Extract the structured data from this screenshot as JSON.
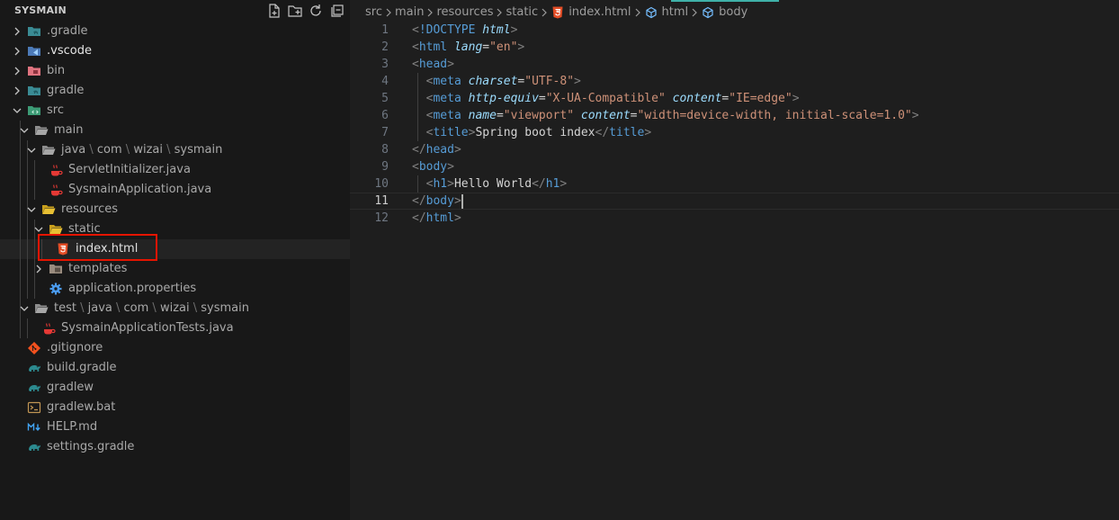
{
  "explorer": {
    "title": "SYSMAIN",
    "actions": [
      "new-file",
      "new-folder",
      "refresh",
      "collapse-all"
    ],
    "items": [
      {
        "label": ".gradle",
        "depth": 0,
        "type": "folder",
        "expanded": false,
        "icon": "folder-gradle-icon"
      },
      {
        "label": ".vscode",
        "depth": 0,
        "type": "folder",
        "expanded": false,
        "icon": "folder-vscode-icon"
      },
      {
        "label": "bin",
        "depth": 0,
        "type": "folder",
        "expanded": false,
        "icon": "folder-bin-icon"
      },
      {
        "label": "gradle",
        "depth": 0,
        "type": "folder",
        "expanded": false,
        "icon": "folder-gradle-icon"
      },
      {
        "label": "src",
        "depth": 0,
        "type": "folder",
        "expanded": true,
        "icon": "folder-src-icon"
      },
      {
        "label": "main",
        "depth": 1,
        "type": "folder",
        "expanded": true,
        "icon": "folder-open-icon"
      },
      {
        "label": "java",
        "compact": [
          "java",
          "com",
          "wizai",
          "sysmain"
        ],
        "depth": 2,
        "type": "folder",
        "expanded": true,
        "icon": "folder-open-icon"
      },
      {
        "label": "ServletInitializer.java",
        "depth": 3,
        "type": "file",
        "icon": "java-file-icon"
      },
      {
        "label": "SysmainApplication.java",
        "depth": 3,
        "type": "file",
        "icon": "java-file-icon"
      },
      {
        "label": "resources",
        "depth": 2,
        "type": "folder",
        "expanded": true,
        "icon": "folder-resources-icon"
      },
      {
        "label": "static",
        "depth": 3,
        "type": "folder",
        "expanded": true,
        "icon": "folder-static-icon"
      },
      {
        "label": "index.html",
        "depth": 4,
        "type": "file",
        "icon": "html-file-icon",
        "selected": true
      },
      {
        "label": "templates",
        "depth": 3,
        "type": "folder",
        "expanded": false,
        "icon": "folder-templates-icon"
      },
      {
        "label": "application.properties",
        "depth": 3,
        "type": "file",
        "icon": "gear-icon"
      },
      {
        "label": "test",
        "compact": [
          "test",
          "java",
          "com",
          "wizai",
          "sysmain"
        ],
        "depth": 1,
        "type": "folder",
        "expanded": true,
        "icon": "folder-test-icon"
      },
      {
        "label": "SysmainApplicationTests.java",
        "depth": 2,
        "type": "file",
        "icon": "java-file-icon"
      },
      {
        "label": ".gitignore",
        "depth": 0,
        "type": "file",
        "icon": "git-icon"
      },
      {
        "label": "build.gradle",
        "depth": 0,
        "type": "file",
        "icon": "gradle-icon"
      },
      {
        "label": "gradlew",
        "depth": 0,
        "type": "file",
        "icon": "gradle-icon"
      },
      {
        "label": "gradlew.bat",
        "depth": 0,
        "type": "file",
        "icon": "terminal-icon"
      },
      {
        "label": "HELP.md",
        "depth": 0,
        "type": "file",
        "icon": "markdown-icon"
      },
      {
        "label": "settings.gradle",
        "depth": 0,
        "type": "file",
        "icon": "gradle-icon"
      }
    ]
  },
  "breadcrumb": [
    {
      "label": "src",
      "icon": null
    },
    {
      "label": "main",
      "icon": null
    },
    {
      "label": "resources",
      "icon": null
    },
    {
      "label": "static",
      "icon": null
    },
    {
      "label": "index.html",
      "icon": "html-file-icon"
    },
    {
      "label": "html",
      "icon": "element-icon"
    },
    {
      "label": "body",
      "icon": "element-icon"
    }
  ],
  "editor": {
    "current_line": 11,
    "lines": [
      {
        "n": "1",
        "indent": 0,
        "tokens": [
          [
            "punc",
            "<"
          ],
          [
            "tag",
            "!DOCTYPE "
          ],
          [
            "attr",
            "html"
          ],
          [
            "punc",
            ">"
          ]
        ]
      },
      {
        "n": "2",
        "indent": 0,
        "tokens": [
          [
            "punc",
            "<"
          ],
          [
            "tag",
            "html "
          ],
          [
            "attr",
            "lang"
          ],
          [
            "text",
            "="
          ],
          [
            "str",
            "\"en\""
          ],
          [
            "punc",
            ">"
          ]
        ]
      },
      {
        "n": "3",
        "indent": 0,
        "tokens": [
          [
            "punc",
            "<"
          ],
          [
            "tag",
            "head"
          ],
          [
            "punc",
            ">"
          ]
        ]
      },
      {
        "n": "4",
        "indent": 1,
        "tokens": [
          [
            "punc",
            "<"
          ],
          [
            "tag",
            "meta "
          ],
          [
            "attr",
            "charset"
          ],
          [
            "text",
            "="
          ],
          [
            "str",
            "\"UTF-8\""
          ],
          [
            "punc",
            ">"
          ]
        ]
      },
      {
        "n": "5",
        "indent": 1,
        "tokens": [
          [
            "punc",
            "<"
          ],
          [
            "tag",
            "meta "
          ],
          [
            "attr",
            "http-equiv"
          ],
          [
            "text",
            "="
          ],
          [
            "str",
            "\"X-UA-Compatible\""
          ],
          [
            "text",
            " "
          ],
          [
            "attr",
            "content"
          ],
          [
            "text",
            "="
          ],
          [
            "str",
            "\"IE=edge\""
          ],
          [
            "punc",
            ">"
          ]
        ]
      },
      {
        "n": "6",
        "indent": 1,
        "tokens": [
          [
            "punc",
            "<"
          ],
          [
            "tag",
            "meta "
          ],
          [
            "attr",
            "name"
          ],
          [
            "text",
            "="
          ],
          [
            "str",
            "\"viewport\""
          ],
          [
            "text",
            " "
          ],
          [
            "attr",
            "content"
          ],
          [
            "text",
            "="
          ],
          [
            "str",
            "\"width=device-width, initial-scale=1.0\""
          ],
          [
            "punc",
            ">"
          ]
        ]
      },
      {
        "n": "7",
        "indent": 1,
        "tokens": [
          [
            "punc",
            "<"
          ],
          [
            "tag",
            "title"
          ],
          [
            "punc",
            ">"
          ],
          [
            "text",
            "Spring boot index"
          ],
          [
            "punc",
            "</"
          ],
          [
            "tag",
            "title"
          ],
          [
            "punc",
            ">"
          ]
        ]
      },
      {
        "n": "8",
        "indent": 0,
        "tokens": [
          [
            "punc",
            "</"
          ],
          [
            "tag",
            "head"
          ],
          [
            "punc",
            ">"
          ]
        ]
      },
      {
        "n": "9",
        "indent": 0,
        "tokens": [
          [
            "punc",
            "<"
          ],
          [
            "tag",
            "body"
          ],
          [
            "punc",
            ">"
          ]
        ]
      },
      {
        "n": "10",
        "indent": 1,
        "tokens": [
          [
            "punc",
            "<"
          ],
          [
            "tag",
            "h1"
          ],
          [
            "punc",
            ">"
          ],
          [
            "text",
            "Hello World"
          ],
          [
            "punc",
            "</"
          ],
          [
            "tag",
            "h1"
          ],
          [
            "punc",
            ">"
          ]
        ]
      },
      {
        "n": "11",
        "indent": 0,
        "tokens": [
          [
            "punc",
            "</"
          ],
          [
            "tag",
            "body"
          ],
          [
            "punc",
            ">"
          ]
        ]
      },
      {
        "n": "12",
        "indent": 0,
        "tokens": [
          [
            "punc",
            "</"
          ],
          [
            "tag",
            "html"
          ],
          [
            "punc",
            ">"
          ]
        ]
      }
    ]
  },
  "colors": {
    "sidebar_bg": "#181818",
    "editor_bg": "#1e1e1e",
    "selection_outline": "#e51400",
    "tag": "#569cd6",
    "attribute": "#9cdcfe",
    "string": "#ce9178",
    "punctuation": "#808080"
  }
}
